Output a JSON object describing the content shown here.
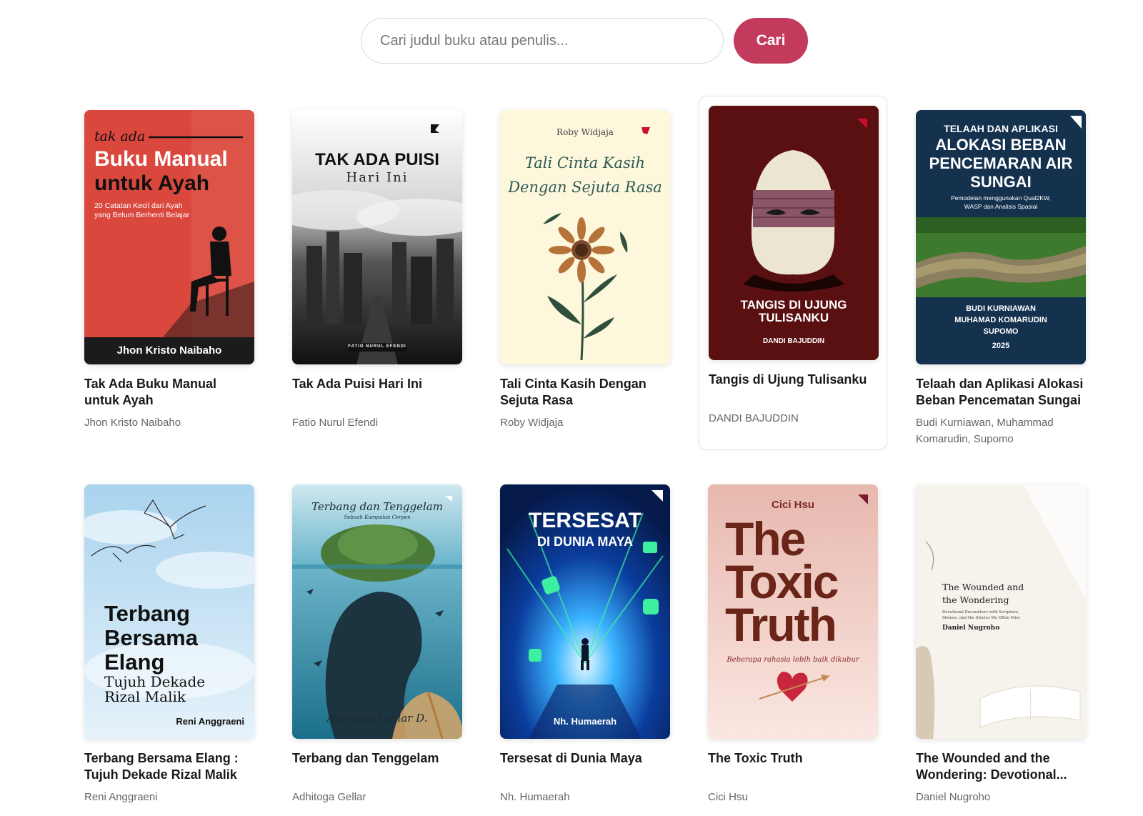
{
  "search": {
    "placeholder": "Cari judul buku atau penulis...",
    "button_label": "Cari"
  },
  "colors": {
    "accent": "#c23a5c"
  },
  "books": [
    {
      "title": "Tak Ada Buku Manual untuk Ayah",
      "author": "Jhon Kristo Naibaho",
      "cover": {
        "line1": "tak ada",
        "line2": "Buku Manual",
        "line3": "untuk Ayah",
        "sub1": "20 Catatan Kecil dari Ayah",
        "sub2": "yang Belum Berhenti Belajar",
        "author": "Jhon Kristo Naibaho"
      }
    },
    {
      "title": "Tak Ada Puisi Hari Ini",
      "author": "Fatio Nurul Efendi",
      "cover": {
        "line1": "TAK ADA PUISI",
        "line2": "Hari Ini",
        "author": "FATIO NURUL EFENDI"
      }
    },
    {
      "title": "Tali Cinta Kasih Dengan Sejuta Rasa",
      "author": "Roby Widjaja",
      "cover": {
        "author": "Roby Widjaja",
        "line1": "Tali Cinta Kasih",
        "line2": "Dengan Sejuta Rasa"
      }
    },
    {
      "title": "Tangis di Ujung Tulisanku",
      "author": "DANDI BAJUDDIN",
      "cover": {
        "line1": "TANGIS DI UJUNG",
        "line2": "TULISANKU",
        "author": "DANDI BAJUDDIN"
      }
    },
    {
      "title": "Telaah dan Aplikasi Alokasi Beban Pencematan Sungai",
      "author": "Budi Kurniawan, Muhammad Komarudin, Supomo",
      "cover": {
        "line1": "TELAAH DAN APLIKASI",
        "line2": "ALOKASI BEBAN",
        "line3": "PENCEMARAN AIR",
        "line4": "SUNGAI",
        "sub1": "Pemodelan menggunakan Qual2KW,",
        "sub2": "WASP dan Analisis Spasial",
        "a1": "BUDI KURNIAWAN",
        "a2": "MUHAMAD KOMARUDIN",
        "a3": "SUPOMO",
        "year": "2025"
      }
    },
    {
      "title": "Terbang Bersama Elang : Tujuh Dekade Rizal Malik",
      "author": "Reni Anggraeni",
      "cover": {
        "line1": "Terbang",
        "line2": "Bersama",
        "line3": "Elang",
        "sub1": "Tujuh Dekade",
        "sub2": "Rizal Malik",
        "author": "Reni Anggraeni"
      }
    },
    {
      "title": "Terbang dan Tenggelam",
      "author": "Adhitoga Gellar",
      "cover": {
        "line1": "Terbang dan Tenggelam",
        "sub1": "Sebuah Kumpulan Cerpen",
        "author": "Adhitoga Gellar D."
      }
    },
    {
      "title": "Tersesat di Dunia Maya",
      "author": "Nh. Humaerah",
      "cover": {
        "line1": "TERSESAT",
        "line2": "DI DUNIA MAYA",
        "author": "Nh. Humaerah"
      }
    },
    {
      "title": "The Toxic Truth",
      "author": "Cici Hsu",
      "cover": {
        "author": "Cici Hsu",
        "line1": "The",
        "line2": "Toxic",
        "line3": "Truth",
        "sub1": "Beberapa rahasia lebih baik dikubur"
      }
    },
    {
      "title": "The Wounded and the Wondering: Devotional...",
      "author": "Daniel Nugroho",
      "cover": {
        "line1": "The Wounded and",
        "line2": "the Wondering",
        "sub1": "Devotional Encounters with Scripture,",
        "sub2": "Silence, and the Stories We Often Miss",
        "author": "Daniel Nugroho"
      }
    }
  ]
}
